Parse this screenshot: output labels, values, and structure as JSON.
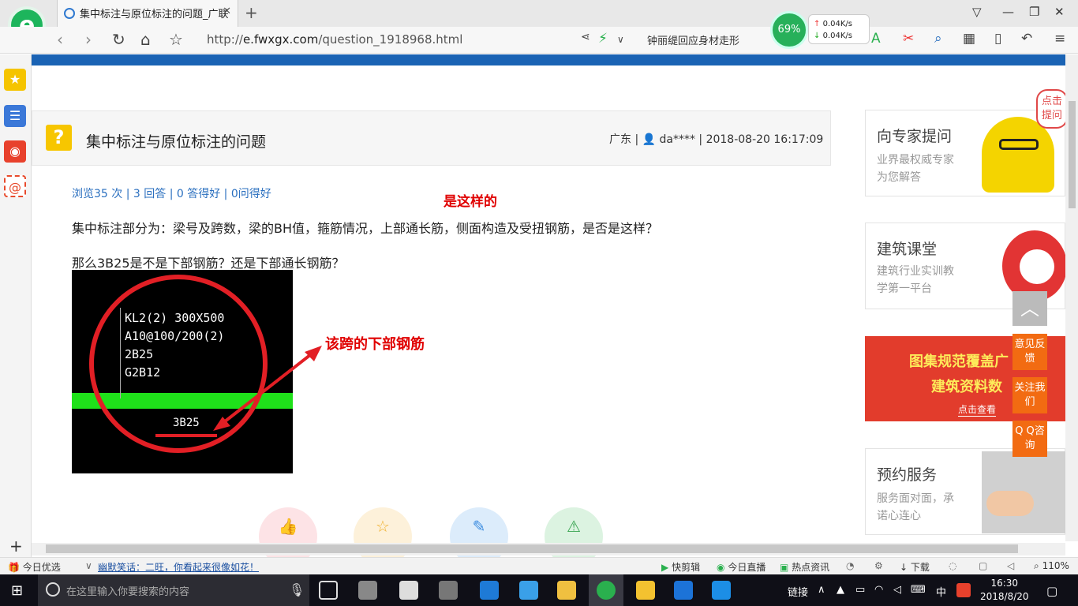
{
  "browser": {
    "tab_title": "集中标注与原位标注的问题_广联",
    "url_host": "e.fwxgx.com",
    "url_prefix": "http://",
    "url_path": "/question_1918968.html",
    "search_hint": "钟丽缇回应身材走形",
    "cpu_percent": "69%",
    "net_up": "0.04K/s",
    "net_down": "0.04K/s"
  },
  "question": {
    "title": "集中标注与原位标注的问题",
    "meta": "广东 | 👤 da**** | 2018-08-20 16:17:09",
    "stats": "浏览35 次 | 3 回答 | 0 答得好 | 0问得好",
    "red_note": "是这样的",
    "para1": "集中标注部分为：梁号及跨数，梁的BH值，箍筋情况，上部通长筋，侧面构造及受扭钢筋，是否是这样？",
    "para2": "那么3B25是不是下部钢筋？还是下部通长钢筋？",
    "image_lines": [
      "KL2(2) 300X500",
      "A10@100/200(2)",
      "2B25",
      "G2B12"
    ],
    "image_bottom": "3B25",
    "annotation": "该跨的下部钢筋"
  },
  "right": {
    "card1_title": "向专家提问",
    "card1_sub1": "业界最权威专家",
    "card1_sub2": "为您解答",
    "bubble": "点击提问",
    "card2_title": "建筑课堂",
    "card2_sub1": "建筑行业实训教",
    "card2_sub2": "学第一平台",
    "banner_t1": "图集规范覆盖广",
    "banner_t2": "建筑资料数",
    "banner_t3": "点击查看",
    "card4_title": "预约服务",
    "card4_sub1": "服务面对面，承",
    "card4_sub2": "诺心连心"
  },
  "floating": {
    "feedback": "意见反馈",
    "follow": "关注我们",
    "qq": "Q Q咨询"
  },
  "statusbar": {
    "today": "今日优选",
    "joke": "幽默笑话：二旺，你看起来很像如花！",
    "clip": "快剪辑",
    "live": "今日直播",
    "news": "热点资讯",
    "download": "下载",
    "zoom": "110%"
  },
  "taskbar": {
    "search_placeholder": "在这里输入你要搜索的内容",
    "link": "链接",
    "ime": "中",
    "time": "16:30",
    "date": "2018/8/20"
  },
  "colors": {
    "accent_blue": "#1a63b4",
    "alert_red": "#e00000",
    "side_orange": "#f26b12"
  }
}
